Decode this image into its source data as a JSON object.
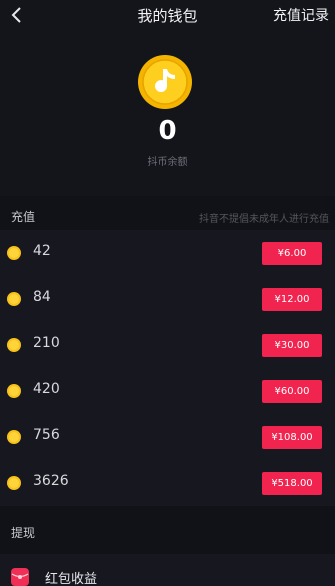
{
  "header": {
    "back_icon": "chevron-left-icon",
    "title": "我的钱包",
    "right_action": "充值记录"
  },
  "wallet": {
    "coin_icon": "douyin-coin-icon",
    "balance": "0",
    "balance_label": "抖币余额"
  },
  "recharge": {
    "title": "充值",
    "note": "抖音不提倡未成年人进行充值",
    "options": [
      {
        "coins": "42",
        "price": "¥6.00"
      },
      {
        "coins": "84",
        "price": "¥12.00"
      },
      {
        "coins": "210",
        "price": "¥30.00"
      },
      {
        "coins": "420",
        "price": "¥60.00"
      },
      {
        "coins": "756",
        "price": "¥108.00"
      },
      {
        "coins": "3626",
        "price": "¥518.00"
      }
    ]
  },
  "withdraw": {
    "title": "提现",
    "items": [
      {
        "icon": "red-envelope-icon",
        "label": "红包收益"
      }
    ]
  },
  "colors": {
    "background": "#111217",
    "accent": "#f1234f",
    "coin": "#f7c21a"
  }
}
